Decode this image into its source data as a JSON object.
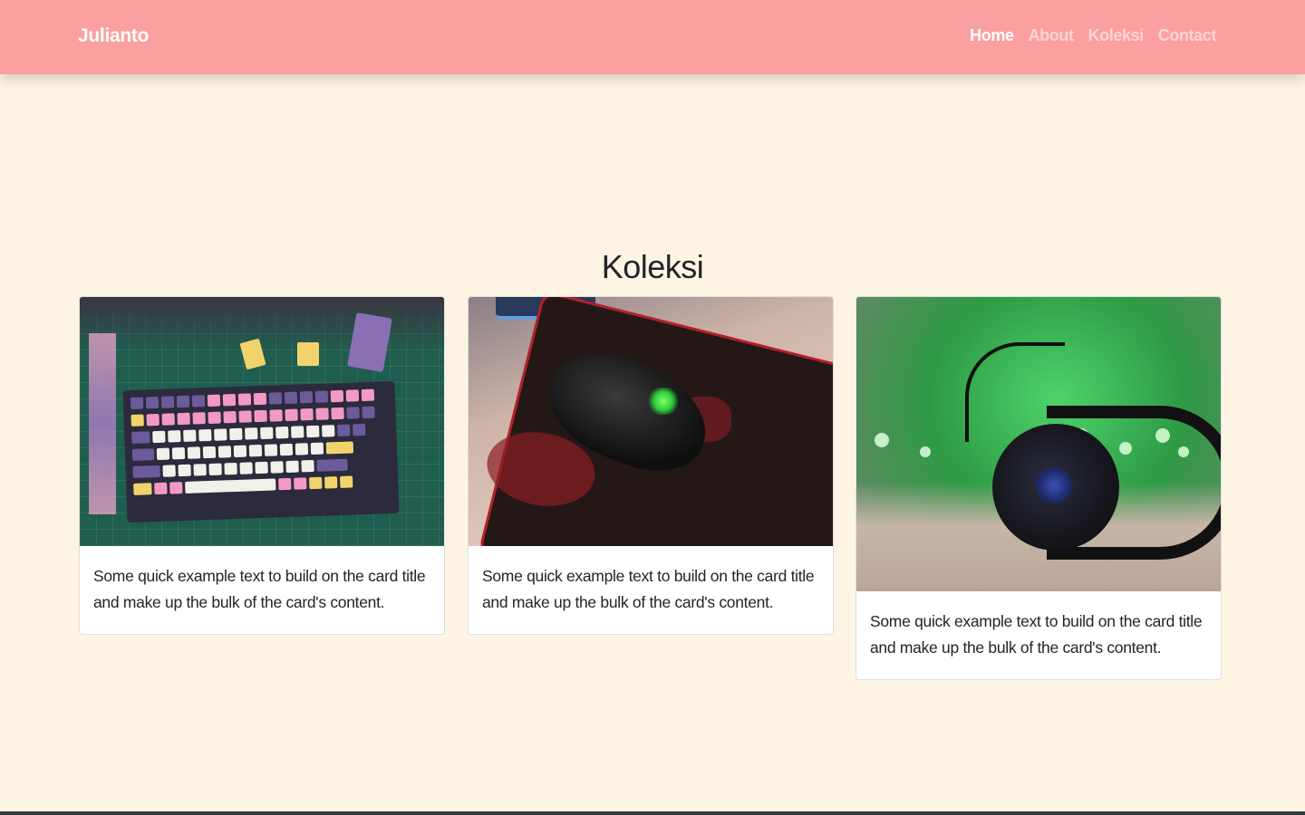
{
  "navbar": {
    "brand": "Julianto",
    "links": [
      {
        "label": "Home",
        "active": true
      },
      {
        "label": "About",
        "active": false
      },
      {
        "label": "Koleksi",
        "active": false
      },
      {
        "label": "Contact",
        "active": false
      }
    ]
  },
  "section": {
    "title": "Koleksi"
  },
  "cards": [
    {
      "image": "mechanical-keyboard-photo",
      "text": "Some quick example text to build on the card title and make up the bulk of the card's content."
    },
    {
      "image": "gaming-mouse-photo",
      "text": "Some quick example text to build on the card title and make up the bulk of the card's content."
    },
    {
      "image": "gaming-headset-photo",
      "text": "Some quick example text to build on the card title and make up the bulk of the card's content."
    }
  ],
  "colors": {
    "navbar": "#fba0a0",
    "background": "#fdf4e3",
    "card": "#ffffff"
  }
}
